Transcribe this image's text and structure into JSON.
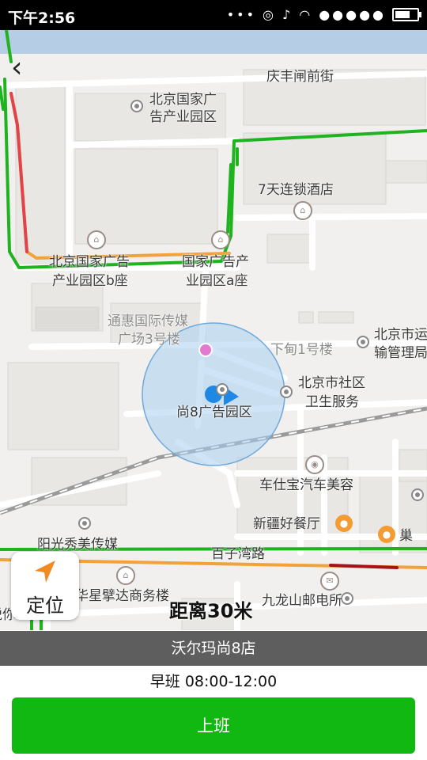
{
  "status_bar": {
    "time": "下午2:56",
    "signal_dots": "●●●●●"
  },
  "map": {
    "labels": {
      "qingfeng": "庆丰闸前街",
      "bj_ad_park_1": "北京国家广",
      "bj_ad_park_2": "告产业园区",
      "hotel": "7天连锁酒店",
      "park_b_1": "北京国家广告",
      "park_b_2": "产业园区b座",
      "park_a_1": "国家广告产",
      "park_a_2": "业园区a座",
      "tonghui_1": "通惠国际传媒",
      "tonghui_2": "广场3号楼",
      "xiadian": "下甸1号楼",
      "transport_1": "北京市运",
      "transport_2": "输管理局",
      "community_1": "北京市社区",
      "community_2": "卫生服务",
      "shang8": "尚8广告园区",
      "carwash": "车仕宝汽车美容",
      "xinjiang": "新疆好餐厅",
      "chao": "巢",
      "yangguang": "阳光秀美传媒",
      "baiziwan": "百子湾路",
      "huaxing": "华星擘达商务楼",
      "jiulong": "九龙山邮电所",
      "left_cut": "悦你"
    },
    "colors": {
      "road_green": "#1fb31f",
      "road_orange": "#f2a23b",
      "road_red": "#e0444a",
      "road_darkred": "#a8101c",
      "accuracy_fill": "#a8cff0",
      "location_blue": "#1e88e5"
    }
  },
  "back_icon": "‹",
  "locate_button": {
    "label": "定位"
  },
  "distance_text": "距离30米",
  "store_name": "沃尔玛尚8店",
  "shift_text": "早班 08:00-12:00",
  "checkin_button": {
    "label": "上班"
  }
}
